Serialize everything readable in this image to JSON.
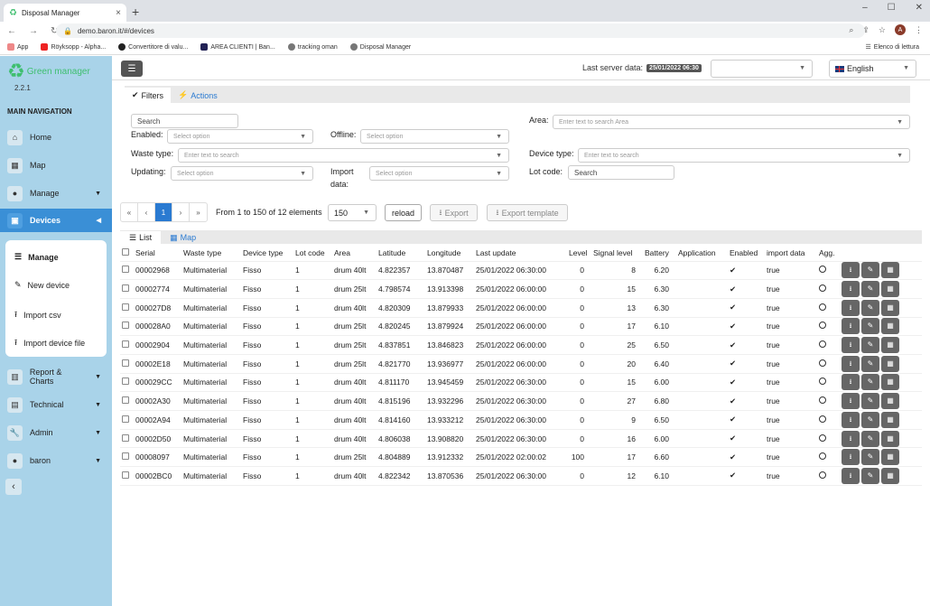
{
  "browser": {
    "tab_title": "Disposal Manager",
    "url": "demo.baron.it/#/devices",
    "avatar": "A",
    "bookmarks": [
      "App",
      "Röyksopp - Alpha...",
      "Convertitore di valu...",
      "AREA CLIENTI | Ban...",
      "tracking oman",
      "Disposal Manager"
    ],
    "reading_list": "Elenco di lettura"
  },
  "app": {
    "name": "Green manager",
    "version": "2.2.1"
  },
  "sidebar": {
    "title": "MAIN NAVIGATION",
    "items": [
      {
        "label": "Home"
      },
      {
        "label": "Map"
      },
      {
        "label": "Manage"
      },
      {
        "label": "Devices"
      },
      {
        "label": "Report & Charts"
      },
      {
        "label": "Technical"
      },
      {
        "label": "Admin"
      },
      {
        "label": "baron"
      }
    ],
    "submenu": [
      "Manage",
      "New device",
      "Import csv",
      "Import device file"
    ]
  },
  "topbar": {
    "last_server_label": "Last server data:",
    "last_server_date": "25/01/2022 06:30",
    "language": "English"
  },
  "filters": {
    "tabs": [
      "Filters",
      "Actions"
    ],
    "search_placeholder": "Search",
    "enabled_label": "Enabled:",
    "enabled_placeholder": "Select option",
    "offline_label": "Offline:",
    "offline_placeholder": "Select option",
    "waste_label": "Waste type:",
    "waste_placeholder": "Enter text to search",
    "updating_label": "Updating:",
    "updating_placeholder": "Select option",
    "import_label_1": "Import",
    "import_label_2": "data:",
    "import_placeholder": "Select option",
    "area_label": "Area:",
    "area_placeholder": "Enter text to search Area",
    "device_type_label": "Device type:",
    "device_type_placeholder": "Enter text to search",
    "lot_label": "Lot code:",
    "lot_placeholder": "Search"
  },
  "pager": {
    "first": "«",
    "prev": "‹",
    "current": "1",
    "next": "›",
    "last": "»",
    "summary": "From 1 to 150 of 12 elements",
    "per_page": "150",
    "reload": "reload",
    "export": "Export",
    "export_template": "Export template"
  },
  "list_tabs": [
    "List",
    "Map"
  ],
  "table": {
    "headers": [
      "Serial",
      "Waste type",
      "Device type",
      "Lot code",
      "Area",
      "Latitude",
      "Longitude",
      "Last update",
      "Level",
      "Signal level",
      "Battery",
      "Application",
      "Enabled",
      "import data",
      "Agg."
    ],
    "rows": [
      [
        "00002968",
        "Multimaterial",
        "Fisso",
        "1",
        "drum 40lt",
        "4.822357",
        "13.870487",
        "25/01/2022 06:30:00",
        "0",
        "8",
        "6.20",
        "",
        "✔",
        "true"
      ],
      [
        "00002774",
        "Multimaterial",
        "Fisso",
        "1",
        "drum 25lt",
        "4.798574",
        "13.913398",
        "25/01/2022 06:00:00",
        "0",
        "15",
        "6.30",
        "",
        "✔",
        "true"
      ],
      [
        "000027D8",
        "Multimaterial",
        "Fisso",
        "1",
        "drum 40lt",
        "4.820309",
        "13.879933",
        "25/01/2022 06:00:00",
        "0",
        "13",
        "6.30",
        "",
        "✔",
        "true"
      ],
      [
        "000028A0",
        "Multimaterial",
        "Fisso",
        "1",
        "drum 25lt",
        "4.820245",
        "13.879924",
        "25/01/2022 06:00:00",
        "0",
        "17",
        "6.10",
        "",
        "✔",
        "true"
      ],
      [
        "00002904",
        "Multimaterial",
        "Fisso",
        "1",
        "drum 25lt",
        "4.837851",
        "13.846823",
        "25/01/2022 06:00:00",
        "0",
        "25",
        "6.50",
        "",
        "✔",
        "true"
      ],
      [
        "00002E18",
        "Multimaterial",
        "Fisso",
        "1",
        "drum 25lt",
        "4.821770",
        "13.936977",
        "25/01/2022 06:00:00",
        "0",
        "20",
        "6.40",
        "",
        "✔",
        "true"
      ],
      [
        "000029CC",
        "Multimaterial",
        "Fisso",
        "1",
        "drum 40lt",
        "4.811170",
        "13.945459",
        "25/01/2022 06:30:00",
        "0",
        "15",
        "6.00",
        "",
        "✔",
        "true"
      ],
      [
        "00002A30",
        "Multimaterial",
        "Fisso",
        "1",
        "drum 40lt",
        "4.815196",
        "13.932296",
        "25/01/2022 06:30:00",
        "0",
        "27",
        "6.80",
        "",
        "✔",
        "true"
      ],
      [
        "00002A94",
        "Multimaterial",
        "Fisso",
        "1",
        "drum 40lt",
        "4.814160",
        "13.933212",
        "25/01/2022 06:30:00",
        "0",
        "9",
        "6.50",
        "",
        "✔",
        "true"
      ],
      [
        "00002D50",
        "Multimaterial",
        "Fisso",
        "1",
        "drum 40lt",
        "4.806038",
        "13.908820",
        "25/01/2022 06:30:00",
        "0",
        "16",
        "6.00",
        "",
        "✔",
        "true"
      ],
      [
        "00008097",
        "Multimaterial",
        "Fisso",
        "1",
        "drum 25lt",
        "4.804889",
        "13.912332",
        "25/01/2022 02:00:02",
        "100",
        "17",
        "6.60",
        "",
        "✔",
        "true"
      ],
      [
        "00002BC0",
        "Multimaterial",
        "Fisso",
        "1",
        "drum 40lt",
        "4.822342",
        "13.870536",
        "25/01/2022 06:30:00",
        "0",
        "12",
        "6.10",
        "",
        "✔",
        "true"
      ]
    ]
  }
}
